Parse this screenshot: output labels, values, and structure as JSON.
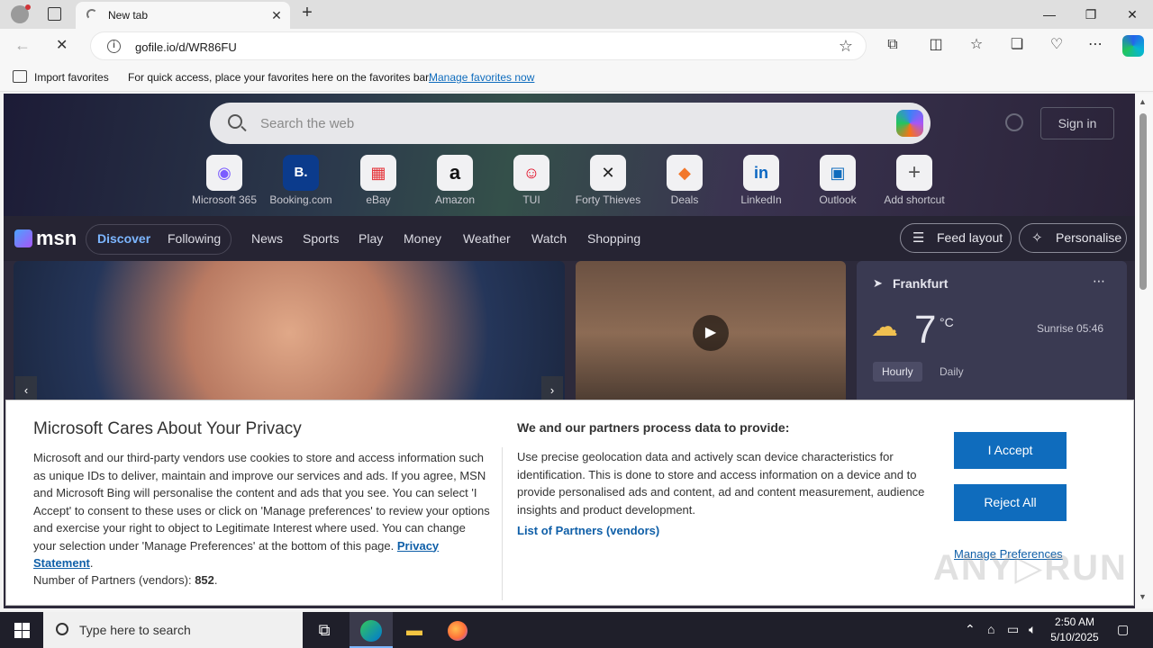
{
  "browser": {
    "tab_title": "New tab",
    "url": "gofile.io/d/WR86FU",
    "favorites_bar": {
      "import_label": "Import favorites",
      "hint": "For quick access, place your favorites here on the favorites bar.",
      "manage_link": "Manage favorites now"
    }
  },
  "newtab": {
    "search_placeholder": "Search the web",
    "sign_in": "Sign in",
    "shortcuts": [
      {
        "label": "Microsoft 365",
        "glyph": "◉"
      },
      {
        "label": "Booking.com",
        "glyph": "B."
      },
      {
        "label": "eBay",
        "glyph": "▦"
      },
      {
        "label": "Amazon",
        "glyph": "a"
      },
      {
        "label": "TUI",
        "glyph": "☺"
      },
      {
        "label": "Forty Thieves",
        "glyph": "✕"
      },
      {
        "label": "Deals",
        "glyph": "◆"
      },
      {
        "label": "LinkedIn",
        "glyph": "in"
      },
      {
        "label": "Outlook",
        "glyph": "▣"
      },
      {
        "label": "Add shortcut",
        "glyph": "+"
      }
    ],
    "msn": {
      "logo": "msn",
      "nav": [
        "Discover",
        "Following",
        "News",
        "Sports",
        "Play",
        "Money",
        "Weather",
        "Watch",
        "Shopping"
      ],
      "feed_layout": "Feed layout",
      "personalise": "Personalise"
    },
    "weather": {
      "city": "Frankfurt",
      "temp": "7",
      "unit": "°C",
      "sunrise": "Sunrise 05:46",
      "tab_hourly": "Hourly",
      "tab_daily": "Daily"
    }
  },
  "privacy": {
    "title": "Microsoft Cares About Your Privacy",
    "body": "Microsoft and our third-party vendors use cookies to store and access information such as unique IDs to deliver, maintain and improve our services and ads. If you agree, MSN and Microsoft Bing will personalise the content and ads that you see. You can select 'I Accept' to consent to these uses or click on 'Manage preferences' to review your options and exercise your right to object to Legitimate Interest where used.  You can change your selection under 'Manage Preferences' at the bottom of this page.",
    "privacy_link": "Privacy Statement",
    "partners_count_label": "Number of Partners (vendors):",
    "partners_count": "852",
    "right_title": "We and our partners process data to provide:",
    "right_body": "Use precise geolocation data and actively scan device characteristics for identification. This is done to store and access information on a device and to provide personalised ads and content, ad and content measurement, audience insights and product development.",
    "partners_link": "List of Partners (vendors)",
    "accept": "I Accept",
    "reject": "Reject All",
    "manage": "Manage Preferences"
  },
  "taskbar": {
    "search_placeholder": "Type here to search",
    "time": "2:50 AM",
    "date": "5/10/2025"
  }
}
